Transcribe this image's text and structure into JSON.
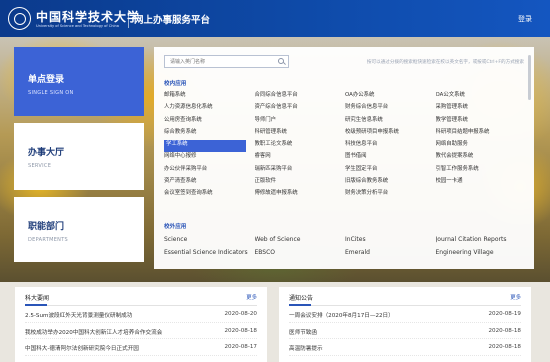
{
  "header": {
    "brand_cn": "中国科学技术大学",
    "brand_en": "University of Science and Technology of China",
    "portal_title": "网上办事服务平台",
    "login_label": "登录"
  },
  "sidebar": [
    {
      "cn": "单点登录",
      "en": "SINGLE SIGN ON"
    },
    {
      "cn": "办事大厅",
      "en": "SERVICE"
    },
    {
      "cn": "职能部门",
      "en": "DEPARTMENTS"
    }
  ],
  "apps": {
    "search_placeholder": "请输入英门名称",
    "hint": "按可以通过分拨的搜索框快速检索在校以英文名字，或按或Ctrl+F的方式搜索",
    "internal_title": "校内应用",
    "external_title": "校外应用",
    "internal": [
      "邮箱系统",
      "合同综合信息平台",
      "OA办公系统",
      "OA公文系统",
      "人力资源信息化系统",
      "资产综合信息平台",
      "财务综合信息平台",
      "采购管理系统",
      "公用房查询系统",
      "导师门户",
      "研究生信息系统",
      "教学管理系统",
      "综合教务系统",
      "科研管理系统",
      "校级预研项目申报系统",
      "科研项目结题申报系统",
      "学工系统",
      "教职工论文系统",
      "科技信息平台",
      "网络自助服务",
      "网络中心报修",
      "睿客网",
      "图书借阅",
      "教代会提案系统",
      "办公伙伴采购平台",
      "瑞新匹采购平台",
      "学生固定平台",
      "引智工作服务系统",
      "资产清查系统",
      "正版软件",
      "旧版综合教务系统",
      "校园一卡通",
      "会议室签到查询系统",
      "傅修故遗申报系统",
      "财务决策分析平台",
      ""
    ],
    "active_index": 16,
    "external": [
      "Science",
      "Web of Science",
      "InCites",
      "Journal Citation Reports",
      "Essential Science Indicators",
      "EBSCO",
      "Emerald",
      "Engineering Village"
    ]
  },
  "news_left": {
    "title": "科大要闻",
    "more": "更多",
    "items": [
      {
        "title": "2.5-Sum波段红外天光背景测量仪研制成功",
        "date": "2020-08-20"
      },
      {
        "title": "我校成功举办2020中国科大创新江人才培养合作交流会",
        "date": "2020-08-18"
      },
      {
        "title": "中国科大-德清阿尔法创新研究院今日正式开园",
        "date": "2020-08-17"
      }
    ]
  },
  "news_right": {
    "title": "通知公告",
    "more": "更多",
    "items": [
      {
        "title": "一周会议安排（2020年8月17日—22日）",
        "date": "2020-08-19"
      },
      {
        "title": "医师节致函",
        "date": "2020-08-18"
      },
      {
        "title": "高温防暑提示",
        "date": "2020-08-18"
      }
    ]
  }
}
